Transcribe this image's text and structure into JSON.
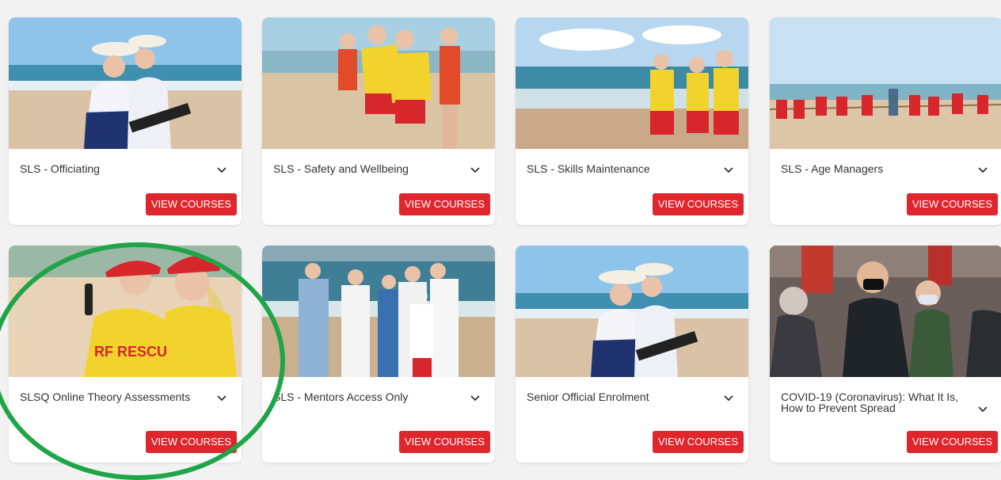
{
  "button_label": "VIEW COURSES",
  "colors": {
    "button": "#e0262d",
    "highlight": "#1fa548",
    "background": "#f2f2f2"
  },
  "cards": [
    {
      "title": "SLS - Officiating",
      "image": "two officials with clipboards on beach"
    },
    {
      "title": "SLS - Safety and Wellbeing",
      "image": "lifesavers with children on beach"
    },
    {
      "title": "SLS - Skills Maintenance",
      "image": "three lifesavers at water's edge"
    },
    {
      "title": "SLS - Age Managers",
      "image": "tug of war on beach"
    },
    {
      "title": "SLSQ Online Theory Assessments",
      "image": "two lifesavers with radio"
    },
    {
      "title": "SLS - Mentors Access Only",
      "image": "group of mentors on beach"
    },
    {
      "title": "Senior Official Enrolment",
      "image": "two officials with clipboards on beach"
    },
    {
      "title": "COVID-19 (Coronavirus): What It Is, How to Prevent Spread",
      "image": "crowd wearing face masks"
    }
  ]
}
